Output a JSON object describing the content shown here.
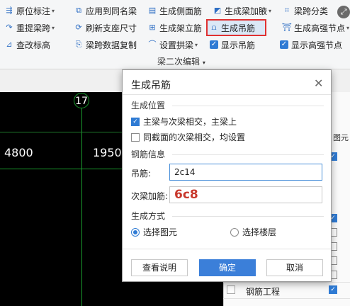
{
  "toolbar": {
    "row1": [
      {
        "label": "原位标注",
        "icon": "align-icon",
        "dropdown": true
      },
      {
        "label": "应用到同名梁",
        "icon": "copy-icon",
        "dropdown": false
      },
      {
        "label": "生成侧面筋",
        "icon": "grid-icon",
        "dropdown": false
      },
      {
        "label": "生成梁加腋",
        "icon": "haunch-icon",
        "dropdown": true
      },
      {
        "label": "梁跨分类",
        "icon": "classify-icon",
        "dropdown": false
      }
    ],
    "row2": [
      {
        "label": "重提梁跨",
        "icon": "redo-icon",
        "dropdown": true
      },
      {
        "label": "刷新支座尺寸",
        "icon": "refresh-icon",
        "dropdown": false
      },
      {
        "label": "生成架立筋",
        "icon": "rebar-icon",
        "dropdown": false
      },
      {
        "label": "生成吊筋",
        "icon": "hanger-icon",
        "dropdown": false,
        "highlighted": true
      },
      {
        "label": "生成高强节点",
        "icon": "node-icon",
        "dropdown": true
      }
    ],
    "row3": [
      {
        "label": "查改标高",
        "icon": "elevation-icon",
        "dropdown": false
      },
      {
        "label": "梁跨数据复制",
        "icon": "copy-data-icon",
        "dropdown": false
      },
      {
        "label": "设置拱梁",
        "icon": "arch-icon",
        "dropdown": true
      },
      {
        "label": "显示吊筋",
        "checked": true
      },
      {
        "label": "显示高强节点",
        "checked": true
      }
    ],
    "group_label": "梁二次编辑"
  },
  "canvas": {
    "axis_label": "17",
    "dim_left": "4800",
    "dim_right": "1950"
  },
  "right_panel": {
    "header": "图元",
    "bottom_label": "钢筋工程"
  },
  "dialog": {
    "title": "生成吊筋",
    "close_glyph": "✕",
    "position_section": "生成位置",
    "opt_main_secondary": "主梁与次梁相交，主梁上",
    "opt_main_secondary_checked": true,
    "opt_same_section": "同截面的次梁相交，均设置",
    "opt_same_section_checked": false,
    "rebar_section": "钢筋信息",
    "hanger_label": "吊筋:",
    "hanger_value": "2c14",
    "stirrup_label": "次梁加筋:",
    "stirrup_value": "6c8",
    "method_section": "生成方式",
    "radio_element": "选择图元",
    "radio_floor": "选择楼层",
    "radio_selected": "选择图元",
    "btn_help": "查看说明",
    "btn_ok": "确定",
    "btn_cancel": "取消"
  },
  "colors": {
    "accent": "#3b7fd9",
    "highlight_border": "#e03131",
    "axis_green": "#1a9c2e",
    "handwriting_red": "#c8382c"
  }
}
